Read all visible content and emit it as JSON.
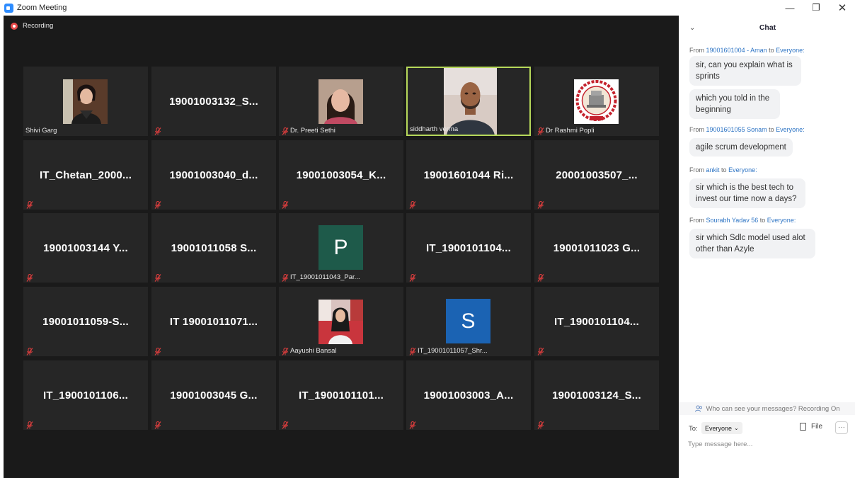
{
  "window": {
    "title": "Zoom Meeting",
    "minimize_glyph": "—",
    "maximize_glyph": "❐",
    "close_glyph": "✕"
  },
  "recording_label": "Recording",
  "tiles": [
    [
      "Shivi Garg",
      "19001003132_S...",
      "Dr. Preeti Sethi",
      "siddharth verma",
      "Dr Rashmi Popli"
    ],
    [
      "IT_Chetan_2000...",
      "19001003040_d...",
      "19001003054_K...",
      "19001601044 Ri...",
      "20001003507_..."
    ],
    [
      "19001003144 Y...",
      "19001011058 S...",
      "IT_19001011043_Par...",
      "IT_1900101104...",
      "19001011023 G..."
    ],
    [
      "19001011059-S...",
      "IT 19001011071...",
      "Aayushi Bansal",
      "IT_19001011057_Shr...",
      "IT_1900101104..."
    ],
    [
      "IT_1900101106...",
      "19001003045 G...",
      "IT_1900101101...",
      "19001003003_A...",
      "19001003124_S..."
    ]
  ],
  "avatars": {
    "p_letter": "P",
    "s_letter": "S",
    "p_color": "#1e5a4a",
    "s_color": "#1b63b3"
  },
  "chat": {
    "collapse_glyph": "⌄",
    "title": "Chat",
    "messages": [
      {
        "from": "From",
        "sender": "19001601004 - Aman",
        "to": "to",
        "recipient": "Everyone:",
        "texts": [
          "sir, can you explain what is sprints",
          "which you told in the beginning"
        ]
      },
      {
        "from": "From",
        "sender": "19001601055 Sonam",
        "to": "to",
        "recipient": "Everyone:",
        "texts": [
          "agile scrum development"
        ]
      },
      {
        "from": "From",
        "sender": "ankit",
        "to": "to",
        "recipient": "Everyone:",
        "texts": [
          "sir which is the best tech to invest our time now a days?"
        ]
      },
      {
        "from": "From",
        "sender": "Sourabh Yadav 56",
        "to": "to",
        "recipient": "Everyone:",
        "texts": [
          "sir which Sdlc model used alot other than Azyle"
        ]
      }
    ],
    "privacy_note": "Who can see your messages? Recording On",
    "to_label": "To:",
    "to_value": "Everyone",
    "file_label": "File",
    "more_glyph": "···",
    "input_placeholder": "Type message here..."
  },
  "colors": {
    "active_speaker": "#b6d85a",
    "mute_red": "#d93d3d",
    "link_blue": "#2d74c4"
  }
}
